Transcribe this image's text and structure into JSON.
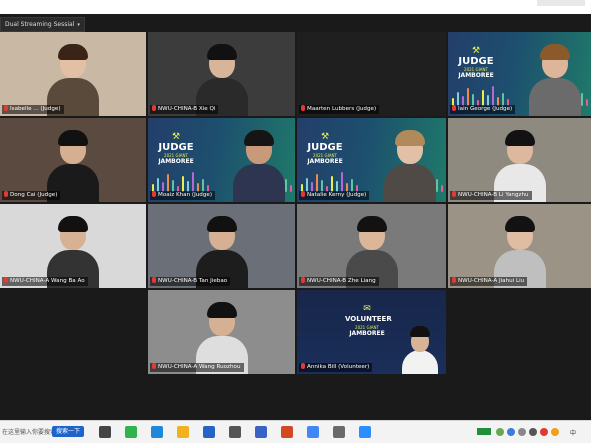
{
  "view_menu": {
    "label": "Dual Streaming Sessial",
    "caret": "▾"
  },
  "judge_badge": {
    "gavel": "⚒",
    "line1": "JUDGE",
    "line2": "2021 GIANT",
    "line3": "JAMBOREE"
  },
  "volunteer_badge": {
    "line1": "VOLUNTEER",
    "line2": "2021 GIANT",
    "line3": "JAMBOREE"
  },
  "participants": [
    {
      "name": "Isabelle ... (Judge)",
      "variant": "camera",
      "bg": "#c9b9a4",
      "shirt": "#5a4a3c",
      "hair": "#3a2418",
      "skin": "#e3bfa6"
    },
    {
      "name": "NWU-CHINA-B Xie Qi",
      "variant": "camera",
      "bg": "#3c3c3c",
      "shirt": "#2a2a2a",
      "hair": "#111",
      "skin": "#d8b49b"
    },
    {
      "name": "Maarten Lubbers (Judge)",
      "variant": "off",
      "bg": "#1f1f1f"
    },
    {
      "name": "Iain George (Judge)",
      "variant": "judge",
      "bg": "#233e6a",
      "shirt": "#6b6b6b",
      "hair": "#8a5a2a",
      "skin": "#dcb59a"
    },
    {
      "name": "Dong Cai (Judge)",
      "variant": "camera",
      "bg": "#5a4a40",
      "shirt": "#1a1a1a",
      "hair": "#111",
      "skin": "#d6ae90"
    },
    {
      "name": "Moaiz Khan (Judge)",
      "variant": "judge",
      "bg": "#223f6b",
      "shirt": "#2d3550",
      "hair": "#151515",
      "skin": "#c99a7a"
    },
    {
      "name": "Natalie Kerny (Judge)",
      "variant": "judge",
      "bg": "#243f6c",
      "shirt": "#4f4a46",
      "hair": "#b08a5a",
      "skin": "#e1c0a6"
    },
    {
      "name": "NWU-CHINA-B Li Yangzhu",
      "variant": "camera",
      "bg": "#8f8a80",
      "shirt": "#e8e8e8",
      "hair": "#121212",
      "skin": "#dcb89e"
    },
    {
      "name": "NWU-CHINA-A Wang Ba Ao",
      "variant": "camera",
      "bg": "#d9d9d9",
      "shirt": "#333",
      "hair": "#111",
      "skin": "#d7b193"
    },
    {
      "name": "NWU-CHINA-B Tan Jiebao",
      "variant": "camera",
      "bg": "#6a6f78",
      "shirt": "#1d1d1d",
      "hair": "#111",
      "skin": "#d6b092"
    },
    {
      "name": "NWU-CHINA-B Zhe Liang",
      "variant": "camera",
      "bg": "#7a7a7a",
      "shirt": "#4a4a4a",
      "hair": "#121212",
      "skin": "#dcb699"
    },
    {
      "name": "NWU-CHINA-A Jiahui Liu",
      "variant": "camera",
      "bg": "#9b9385",
      "shirt": "#bfbfbf",
      "hair": "#121212",
      "skin": "#e0bca2"
    },
    {
      "name": "NWU-CHINA-A Wang Ruozhou",
      "variant": "camera",
      "bg": "#8d8d8d",
      "shirt": "#dedede",
      "hair": "#111",
      "skin": "#d5b093"
    },
    {
      "name": "Annika Bill (Volunteer)",
      "variant": "volunteer",
      "bg": "#1a2a4f",
      "shirt": "#f2f2f2",
      "hair": "#111",
      "skin": "#d9b396"
    }
  ],
  "taskbar": {
    "search_text": "在这里输入你要搜索的内容",
    "search_button": "搜索一下",
    "tray_text": "中",
    "app_icons": [
      "task-view-icon",
      "wechat-icon",
      "edge-icon",
      "file-explorer-icon",
      "mail-icon",
      "store-icon",
      "visio-icon",
      "powerpoint-icon",
      "chrome-icon",
      "camera-icon",
      "zoom-icon"
    ],
    "app_icon_colors": [
      "#444",
      "#2fb34a",
      "#1c8ad6",
      "#f2b21b",
      "#2563c7",
      "#555",
      "#3a62c6",
      "#d24726",
      "#4285f4",
      "#6a6a6a",
      "#2d8cff"
    ]
  },
  "colors": {
    "judge_accent": "#e6f04a",
    "mic_muted": "#e53935",
    "active_speaker": "#9ad43a"
  }
}
